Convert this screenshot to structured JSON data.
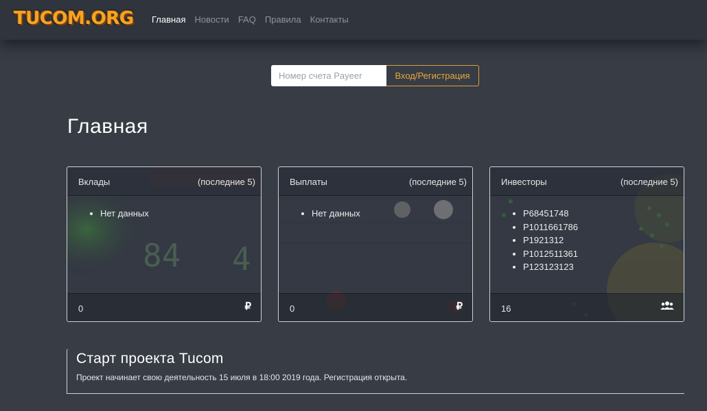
{
  "brand": {
    "logo": "TUCOM.ORG"
  },
  "nav": {
    "items": [
      {
        "label": "Главная",
        "active": true
      },
      {
        "label": "Новости",
        "active": false
      },
      {
        "label": "FAQ",
        "active": false
      },
      {
        "label": "Правила",
        "active": false
      },
      {
        "label": "Контакты",
        "active": false
      }
    ]
  },
  "login": {
    "placeholder": "Номер счета Payeer",
    "value": "",
    "button_label": "Вход/Регистрация"
  },
  "page": {
    "title": "Главная"
  },
  "cards": [
    {
      "title": "Вклады",
      "subtitle": "(последние 5)",
      "items": [
        "Нет данных"
      ],
      "count": "0",
      "icon": "ruble-icon",
      "icon_glyph": "₽"
    },
    {
      "title": "Выплаты",
      "subtitle": "(последние 5)",
      "items": [
        "Нет данных"
      ],
      "count": "0",
      "icon": "ruble-icon",
      "icon_glyph": "₽"
    },
    {
      "title": "Инвесторы",
      "subtitle": "(последние 5)",
      "items": [
        "P68451748",
        "P1011661786",
        "P1921312",
        "P1012511361",
        "P123123123"
      ],
      "count": "16",
      "icon": "users-icon",
      "icon_glyph": "👥"
    }
  ],
  "news": {
    "title": "Старт проекта Tucom",
    "text": "Проект начинает свою деятельность 15 июля в 18:00 2019 года. Регистрация открыта."
  },
  "colors": {
    "background": "#373c45",
    "navbar": "#30343c",
    "accent": "#e7a93c",
    "logo": "#f4a622"
  }
}
